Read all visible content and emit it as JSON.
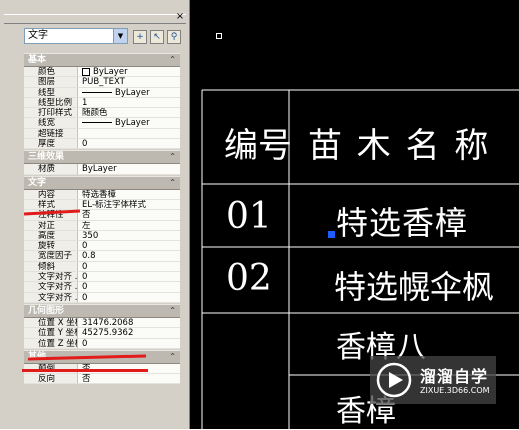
{
  "palette": {
    "close_glyph": "×",
    "object_type": "文字",
    "sections": [
      {
        "title": "基本",
        "rows": [
          {
            "k": "颜色",
            "v": "ByLayer",
            "swatch": true
          },
          {
            "k": "图层",
            "v": "PUB_TEXT"
          },
          {
            "k": "线型",
            "v": "ByLayer",
            "line": true
          },
          {
            "k": "线型比例",
            "v": "1"
          },
          {
            "k": "打印样式",
            "v": "随颜色"
          },
          {
            "k": "线宽",
            "v": "ByLayer",
            "line": true
          },
          {
            "k": "超链接",
            "v": ""
          },
          {
            "k": "厚度",
            "v": "0"
          }
        ]
      },
      {
        "title": "三维效果",
        "rows": [
          {
            "k": "材质",
            "v": "ByLayer"
          }
        ]
      },
      {
        "title": "文字",
        "rows": [
          {
            "k": "内容",
            "v": "特选香樟"
          },
          {
            "k": "样式",
            "v": "EL-标注字体样式"
          },
          {
            "k": "注释性",
            "v": "否"
          },
          {
            "k": "对正",
            "v": "左"
          },
          {
            "k": "高度",
            "v": "350"
          },
          {
            "k": "旋转",
            "v": "0"
          },
          {
            "k": "宽度因子",
            "v": "0.8"
          },
          {
            "k": "倾斜",
            "v": "0"
          },
          {
            "k": "文字对齐 ...",
            "v": "0"
          },
          {
            "k": "文字对齐 ...",
            "v": "0"
          },
          {
            "k": "文字对齐 ...",
            "v": "0"
          }
        ]
      },
      {
        "title": "几何图形",
        "rows": [
          {
            "k": "位置 X 坐标",
            "v": "31476.2068"
          },
          {
            "k": "位置 Y 坐标",
            "v": "45275.9362"
          },
          {
            "k": "位置 Z 坐标",
            "v": "0"
          }
        ]
      },
      {
        "title": "其他",
        "rows": [
          {
            "k": "颠倒",
            "v": "否"
          },
          {
            "k": "反向",
            "v": "否"
          }
        ]
      }
    ]
  },
  "drawing": {
    "header_no": "编号",
    "header_name": "苗 木 名 称",
    "row1_no": "01",
    "row1_name": "特选香樟",
    "row2_no": "02",
    "row2_name": "特选幌伞枫",
    "row3_name": "香樟八",
    "row4_name": "香樟"
  },
  "watermark": {
    "title": "溜溜自学",
    "subtitle": "ZIXUE.3D66.COM"
  },
  "colors": {
    "canvas_bg": "#000000",
    "annotation_red": "#e11a1a",
    "selection_grip": "#1e5eff"
  }
}
